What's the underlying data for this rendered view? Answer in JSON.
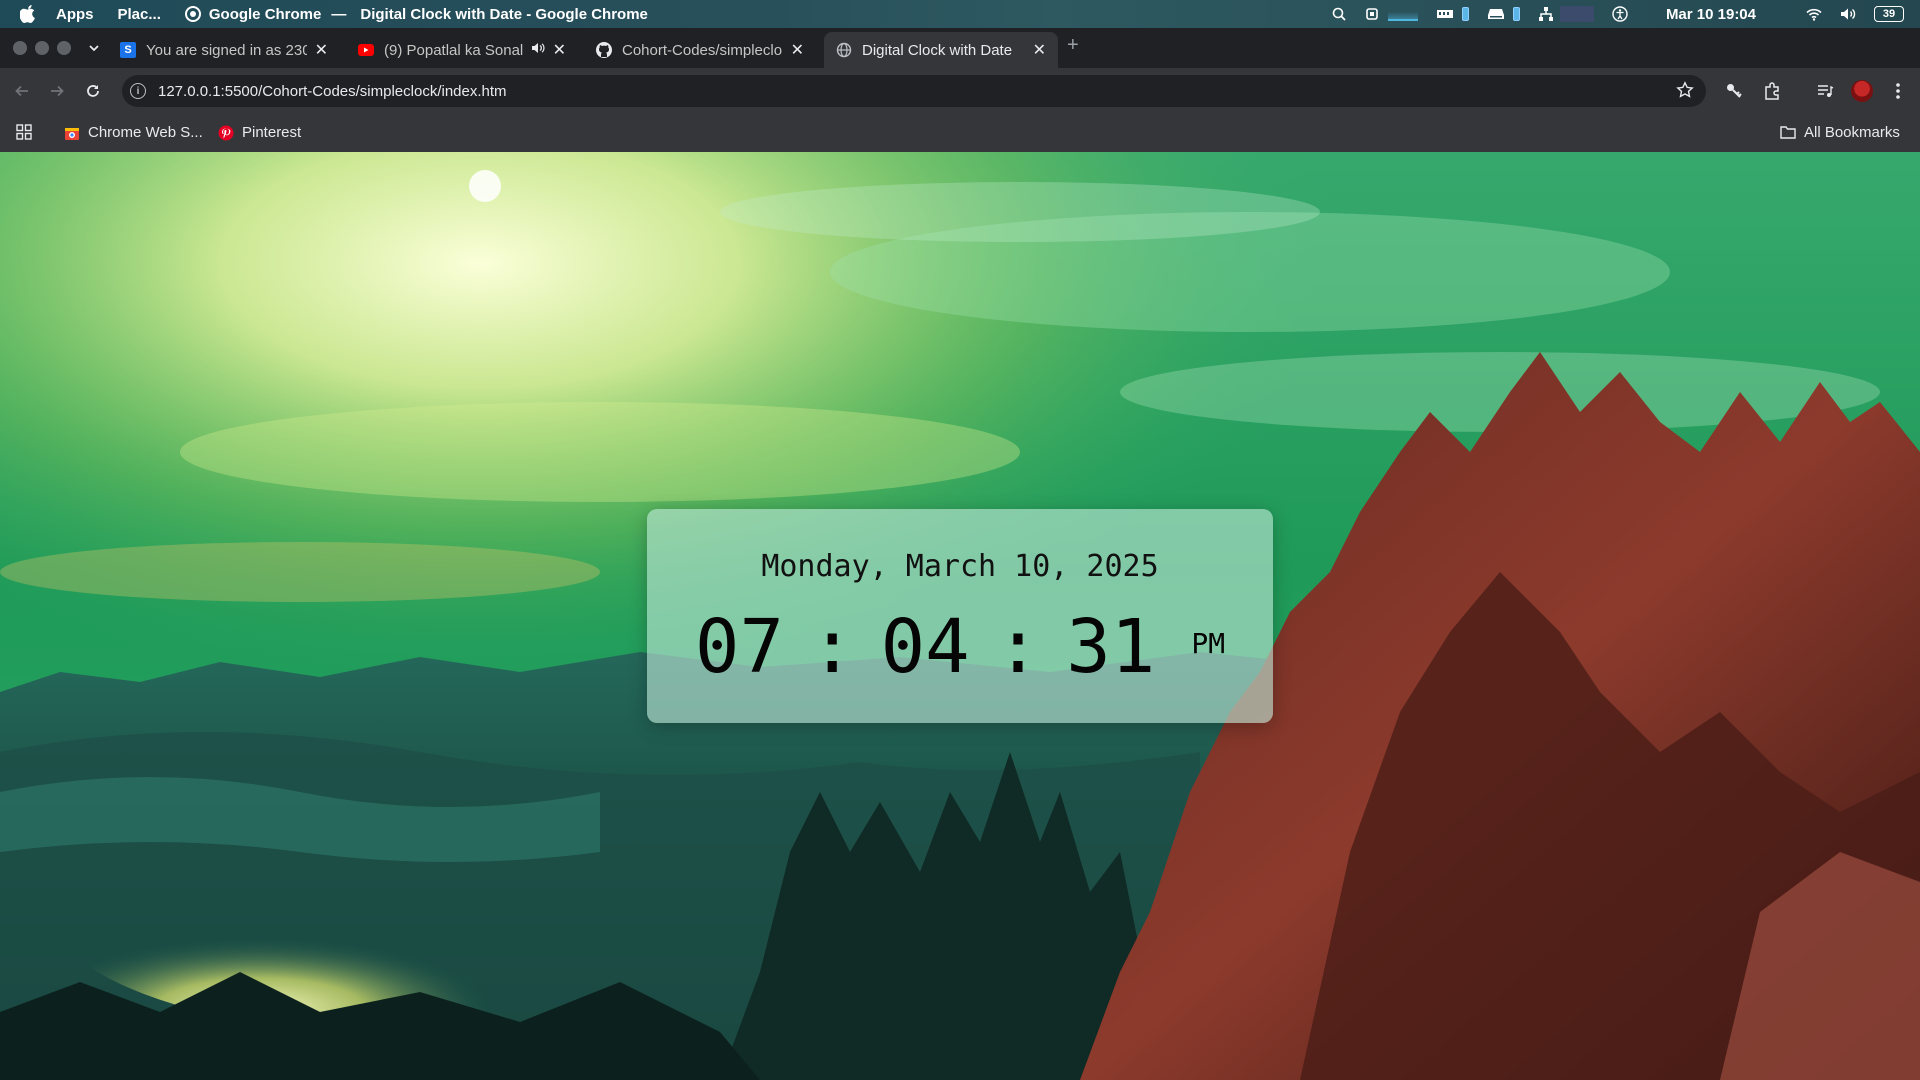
{
  "os_bar": {
    "menu_apps": "Apps",
    "menu_places": "Plac...",
    "app_name": "Google Chrome",
    "separator": "—",
    "window_title": "Digital Clock with Date - Google Chrome",
    "datetime": "Mar 10  19:04",
    "battery": "39"
  },
  "tabs": [
    {
      "title": "You are signed in as 230",
      "favicon": "S",
      "active": false
    },
    {
      "title": "(9) Popatlal ka Sonal",
      "favicon": "youtube-icon",
      "audio": true,
      "active": false
    },
    {
      "title": "Cohort-Codes/simpleclo",
      "favicon": "github-icon",
      "active": false
    },
    {
      "title": "Digital Clock with Date",
      "favicon": "globe-icon",
      "active": true
    }
  ],
  "new_tab_label": "+",
  "toolbar": {
    "url": "127.0.0.1:5500/Cohort-Codes/simpleclock/index.htm"
  },
  "bookmarks": {
    "items": [
      {
        "label": "Chrome Web S..."
      },
      {
        "label": "Pinterest"
      }
    ],
    "all_bookmarks": "All Bookmarks"
  },
  "clock": {
    "date": "Monday, March 10, 2025",
    "hours": "07",
    "minutes": "04",
    "seconds": "31",
    "colon": ":",
    "ampm": "PM"
  },
  "colors": {
    "chrome_dark": "#202124",
    "chrome_toolbar": "#35363a",
    "card_tint": "#bee6d7"
  }
}
